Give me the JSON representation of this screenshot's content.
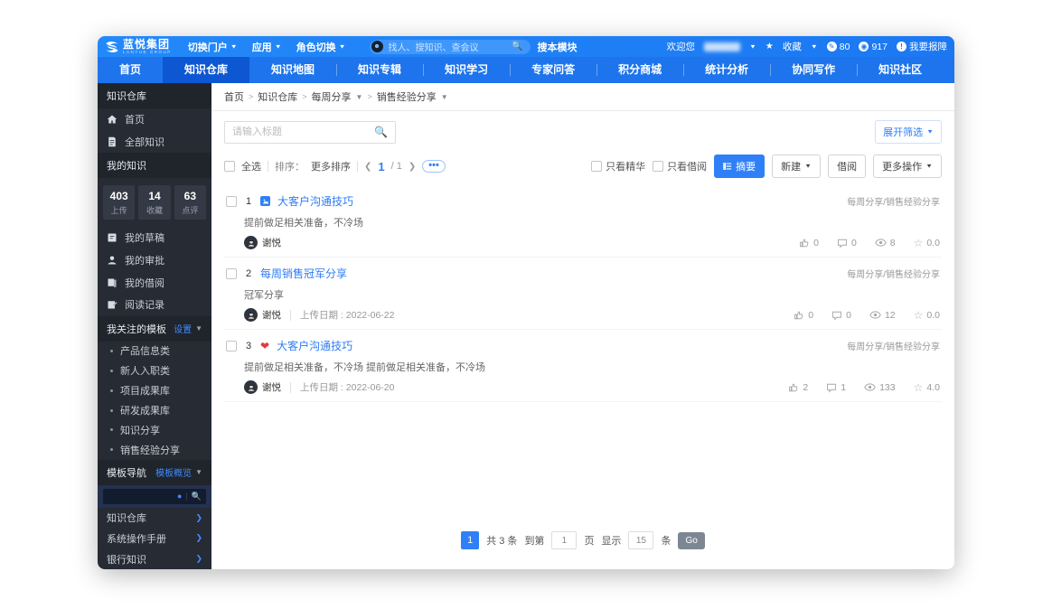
{
  "topbar": {
    "logo_title": "蓝悦集团",
    "logo_subtitle": "LANYUE GROUP",
    "menus": [
      "切换门户",
      "应用",
      "角色切换"
    ],
    "search_placeholder": "找人、搜知识、查会议",
    "module_search_label": "搜本模块",
    "welcome_label": "欢迎您",
    "favorite_label": "收藏",
    "edit_count": "80",
    "view_count": "917",
    "help_label": "我要报障"
  },
  "nav": {
    "tabs": [
      "首页",
      "知识仓库",
      "知识地图",
      "知识专辑",
      "知识学习",
      "专家问答",
      "积分商城",
      "统计分析",
      "协同写作",
      "知识社区"
    ],
    "active": "知识仓库"
  },
  "sidebar": {
    "section_repo": "知识仓库",
    "home": "首页",
    "all_knowledge": "全部知识",
    "section_mine": "我的知识",
    "stats": [
      {
        "value": "403",
        "label": "上传"
      },
      {
        "value": "14",
        "label": "收藏"
      },
      {
        "value": "63",
        "label": "点评"
      }
    ],
    "my_drafts": "我的草稿",
    "my_approvals": "我的审批",
    "my_borrows": "我的借阅",
    "reading_history": "阅读记录",
    "section_followed": "我关注的模板",
    "settings_link": "设置",
    "followed_items": [
      "产品信息类",
      "新人入职类",
      "项目成果库",
      "研发成果库",
      "知识分享",
      "销售经验分享"
    ],
    "section_template_nav": "模板导航",
    "template_overview_link": "模板概览",
    "tree_items": [
      "知识仓库",
      "系统操作手册",
      "银行知识"
    ]
  },
  "main": {
    "breadcrumb": [
      "首页",
      "知识仓库",
      "每周分享",
      "销售经验分享"
    ],
    "breadcrumb_sep": ">",
    "search_placeholder": "请输入标题",
    "expand_filter": "展开筛选",
    "select_all": "全选",
    "sort_label": "排序：",
    "sort_more": "更多排序",
    "pager_current": "1",
    "pager_total": "/ 1",
    "only_essence": "只看精华",
    "only_borrowed": "只看借阅",
    "abstract_btn": "摘要",
    "new_btn": "新建",
    "borrow_btn": "借阅",
    "more_ops_btn": "更多操作",
    "upload_date_label": "上传日期 :",
    "list": [
      {
        "index": "1",
        "title": "大客户沟通技巧",
        "summary": "提前做足相关准备，不冷场",
        "author": "谢悦",
        "date": "",
        "category": "每周分享/销售经验分享",
        "likes": "0",
        "comments": "0",
        "views": "8",
        "rating": "0.0"
      },
      {
        "index": "2",
        "title": "每周销售冠军分享",
        "summary": "冠军分享",
        "author": "谢悦",
        "date": "2022-06-22",
        "category": "每周分享/销售经验分享",
        "likes": "0",
        "comments": "0",
        "views": "12",
        "rating": "0.0"
      },
      {
        "index": "3",
        "title": "大客户沟通技巧",
        "summary": "提前做足相关准备，不冷场 提前做足相关准备，不冷场",
        "author": "谢悦",
        "date": "2022-06-20",
        "category": "每周分享/销售经验分享",
        "likes": "2",
        "comments": "1",
        "views": "133",
        "rating": "4.0"
      }
    ],
    "pagination": {
      "page": "1",
      "total_label": "共 3 条",
      "to_label": "到第",
      "page_input": "1",
      "page_unit": "页",
      "show_label": "显示",
      "size_input": "15",
      "size_unit": "条",
      "go_label": "Go"
    }
  }
}
